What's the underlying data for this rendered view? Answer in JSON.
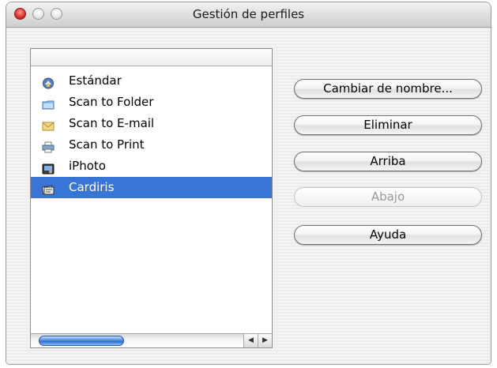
{
  "window": {
    "title": "Gestión de perfiles"
  },
  "profiles": {
    "items": [
      {
        "label": "Estándar",
        "icon": "standard-icon",
        "selected": false
      },
      {
        "label": "Scan to Folder",
        "icon": "folder-icon",
        "selected": false
      },
      {
        "label": "Scan to E-mail",
        "icon": "email-icon",
        "selected": false
      },
      {
        "label": "Scan to Print",
        "icon": "printer-icon",
        "selected": false
      },
      {
        "label": "iPhoto",
        "icon": "iphoto-icon",
        "selected": false
      },
      {
        "label": "Cardiris",
        "icon": "cardiris-icon",
        "selected": true
      }
    ]
  },
  "buttons": {
    "rename": "Cambiar de nombre...",
    "delete": "Eliminar",
    "up": "Arriba",
    "down": "Abajo",
    "help": "Ayuda"
  },
  "colors": {
    "selection": "#3875d7",
    "close_button": "#e3322b"
  }
}
